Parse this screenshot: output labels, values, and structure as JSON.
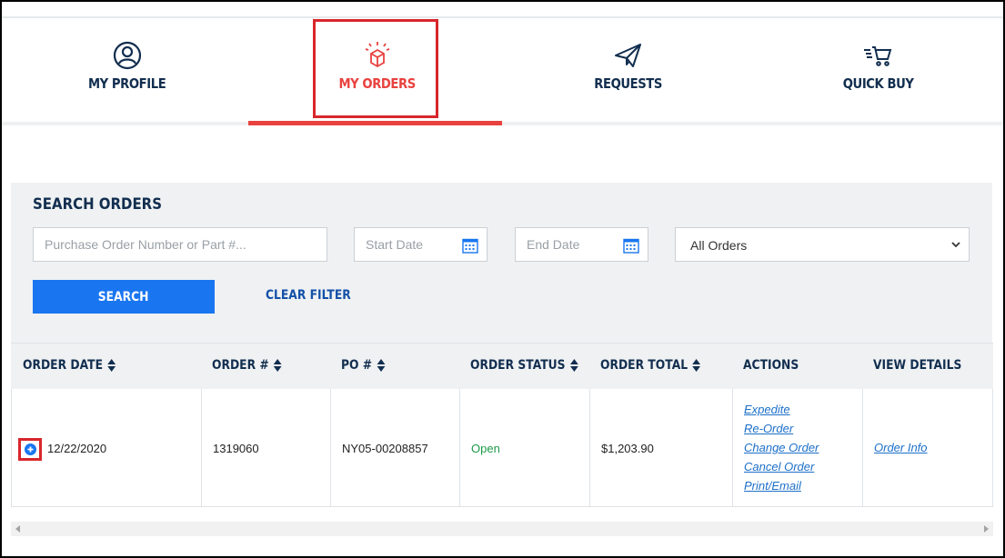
{
  "nav": {
    "items": [
      {
        "label": "MY PROFILE",
        "icon": "user-circle-icon"
      },
      {
        "label": "MY ORDERS",
        "icon": "box-icon",
        "active": true
      },
      {
        "label": "REQUESTS",
        "icon": "paper-plane-icon"
      },
      {
        "label": "QUICK BUY",
        "icon": "cart-icon"
      }
    ]
  },
  "search": {
    "title": "SEARCH ORDERS",
    "po_placeholder": "Purchase Order Number or Part #...",
    "start_placeholder": "Start Date",
    "end_placeholder": "End Date",
    "status_selected": "All Orders",
    "search_label": "SEARCH",
    "clear_label": "CLEAR FILTER"
  },
  "table": {
    "headers": {
      "order_date": "ORDER DATE",
      "order_no": "ORDER #",
      "po_no": "PO #",
      "status": "ORDER STATUS",
      "total": "ORDER TOTAL",
      "actions": "ACTIONS",
      "details": "VIEW DETAILS"
    },
    "rows": [
      {
        "order_date": "12/22/2020",
        "order_no": "1319060",
        "po_no": "NY05-00208857",
        "status": "Open",
        "total": "$1,203.90",
        "actions": [
          "Expedite",
          "Re-Order",
          "Change Order",
          "Cancel Order",
          "Print/Email"
        ],
        "details": "Order Info"
      }
    ]
  },
  "colors": {
    "accent": "#e8423f",
    "primary_blue": "#1976f0",
    "navy": "#122e4f",
    "status_open": "#1e9a4a"
  }
}
